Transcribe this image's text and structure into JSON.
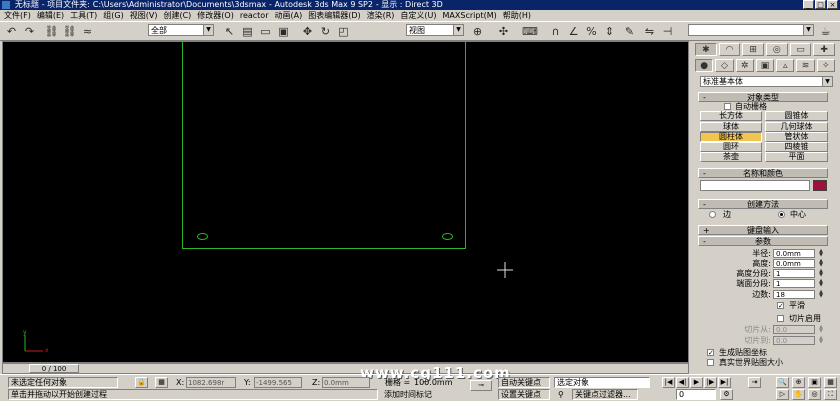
{
  "title": {
    "doc": "无标题",
    "sep1": "- 项目文件夹:",
    "path": "C:\\Users\\Administrator\\Documents\\3dsmax",
    "sep2": "- Autodesk 3ds Max 9 SP2",
    "mode": "- 显示 : Direct 3D"
  },
  "window_buttons": [
    "_",
    "□",
    "×"
  ],
  "menu": [
    "文件(F)",
    "编辑(E)",
    "工具(T)",
    "组(G)",
    "视图(V)",
    "创建(C)",
    "修改器(O)",
    "reactor",
    "动画(A)",
    "图表编辑器(D)",
    "渲染(R)",
    "自定义(U)",
    "MAXScript(M)",
    "帮助(H)"
  ],
  "toolbar": {
    "selection_filter": "全部",
    "ref_coord": "视图",
    "named_selection": ""
  },
  "viewport": {
    "label": "",
    "crosshair_icon": "crosshair",
    "axis": {
      "y": "y",
      "x": "x"
    }
  },
  "watermark": "www.cg111.com",
  "command_panel": {
    "tabs": [
      "create-tab",
      "modify-tab",
      "hierarchy-tab",
      "motion-tab",
      "display-tab",
      "utilities-tab"
    ],
    "subtabs": [
      "geometry",
      "shapes",
      "lights",
      "cameras",
      "helpers",
      "spacewarps",
      "systems"
    ],
    "category": "标准基本体",
    "object_type": {
      "header": "对象类型",
      "autogrid": "自动栅格",
      "buttons": [
        "长方体",
        "圆锥体",
        "球体",
        "几何球体",
        "圆柱体",
        "管状体",
        "圆环",
        "四棱锥",
        "茶壶",
        "平面"
      ],
      "selected_index": 4
    },
    "name_color": {
      "header": "名称和颜色",
      "name": "",
      "color": "#a0103c"
    },
    "creation_method": {
      "header": "创建方法",
      "edge": "边",
      "center": "中心"
    },
    "keyboard_entry": {
      "header": "键盘输入",
      "pm": "+"
    },
    "params": {
      "header": "参数",
      "radius_label": "半径:",
      "radius": "0.0mm",
      "height_label": "高度:",
      "height": "0.0mm",
      "height_segs_label": "高度分段:",
      "height_segs": "1",
      "cap_segs_label": "端面分段:",
      "cap_segs": "1",
      "sides_label": "边数:",
      "sides": "18",
      "smooth": "平滑",
      "slice_on": "切片启用",
      "slice_from_label": "切片从:",
      "slice_from": "0.0",
      "slice_to_label": "切片到:",
      "slice_to": "0.0",
      "gen_map": "生成贴图坐标",
      "real_world": "真实世界贴图大小"
    }
  },
  "time": {
    "slider": "0 / 100"
  },
  "status": {
    "selection": "未选定任何对象",
    "prompt": "单击并拖动以开始创建过程",
    "x_label": "X:",
    "x": "1082.698r",
    "y_label": "Y:",
    "y": "-1499.565",
    "z_label": "Z:",
    "z": "0.0mm",
    "grid_label": "栅格 =",
    "grid": "100.0mm",
    "add_time_tag": "添加时间标记",
    "auto_key": "自动关键点",
    "set_key": "设置关键点",
    "key_mode": "选定对象",
    "key_filters": "关键点过滤器...",
    "frame": "0"
  }
}
